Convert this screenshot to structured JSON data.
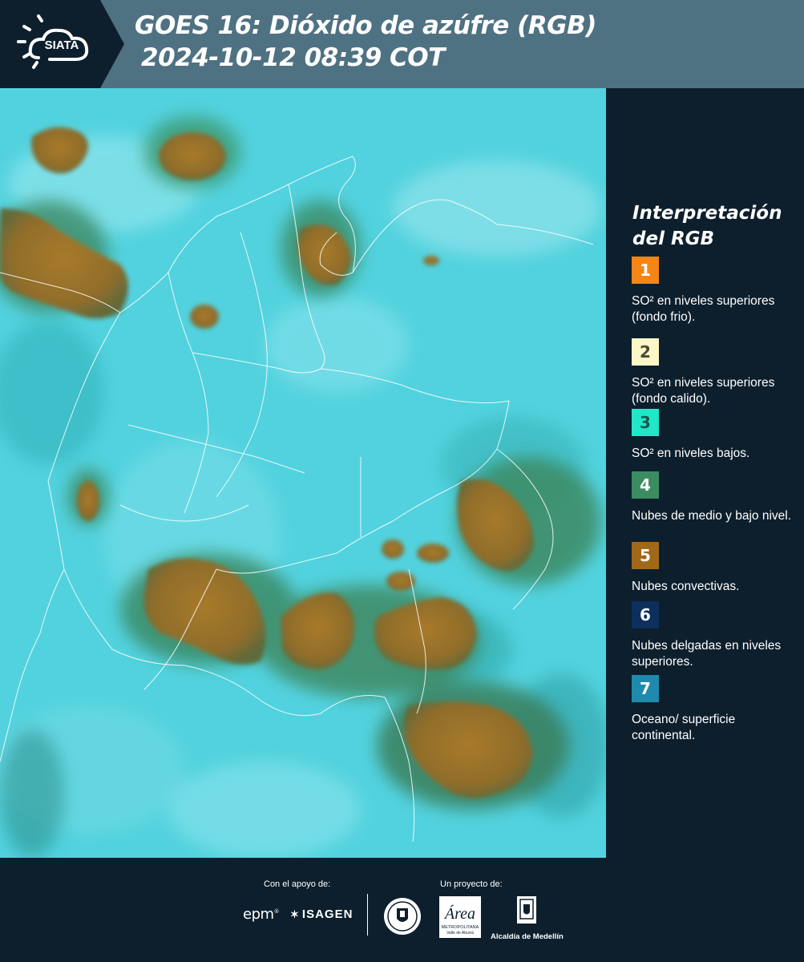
{
  "header": {
    "logo_text": "SIATA",
    "title_line1": "GOES 16: Dióxido de azúfre (RGB)",
    "title_line2": "2024-10-12 08:39 COT"
  },
  "legend": {
    "title_line1": "Interpretación",
    "title_line2": "del RGB",
    "items": [
      {
        "number": "1",
        "color": "#f58514",
        "text_color": "#ffffff",
        "label": "SO² en niveles superiores (fondo frio)."
      },
      {
        "number": "2",
        "color": "#fbf7c7",
        "text_color": "#4a4a3a",
        "label": "SO² en niveles superiores (fondo calido)."
      },
      {
        "number": "3",
        "color": "#21e7c6",
        "text_color": "#19594e",
        "label": "SO² en niveles bajos."
      },
      {
        "number": "4",
        "color": "#3c8c62",
        "text_color": "#ffffff",
        "label": "Nubes de medio y bajo nivel."
      },
      {
        "number": "5",
        "color": "#a0691a",
        "text_color": "#ffffff",
        "label": "Nubes convectivas."
      },
      {
        "number": "6",
        "color": "#0c2f5e",
        "text_color": "#ffffff",
        "label": "Nubes delgadas en niveles superiores."
      },
      {
        "number": "7",
        "color": "#1f8aae",
        "text_color": "#ffffff",
        "label": "Oceano/ superficie continental."
      }
    ]
  },
  "footer": {
    "support_label": "Con el apoyo de:",
    "project_label": "Un proyecto de:",
    "epm": "epm",
    "isagen": "ISAGEN",
    "area_text": "Área",
    "area_sub1": "METROPOLITANA",
    "area_sub2": "Valle de Aburrá",
    "alcaldia": "Alcaldía de Medellín"
  },
  "colors": {
    "header_bg": "#4f7283",
    "panel_bg": "#0d1f2d",
    "sky_cyan": "#4ed3df",
    "cloud_brown": "#9d7428"
  }
}
